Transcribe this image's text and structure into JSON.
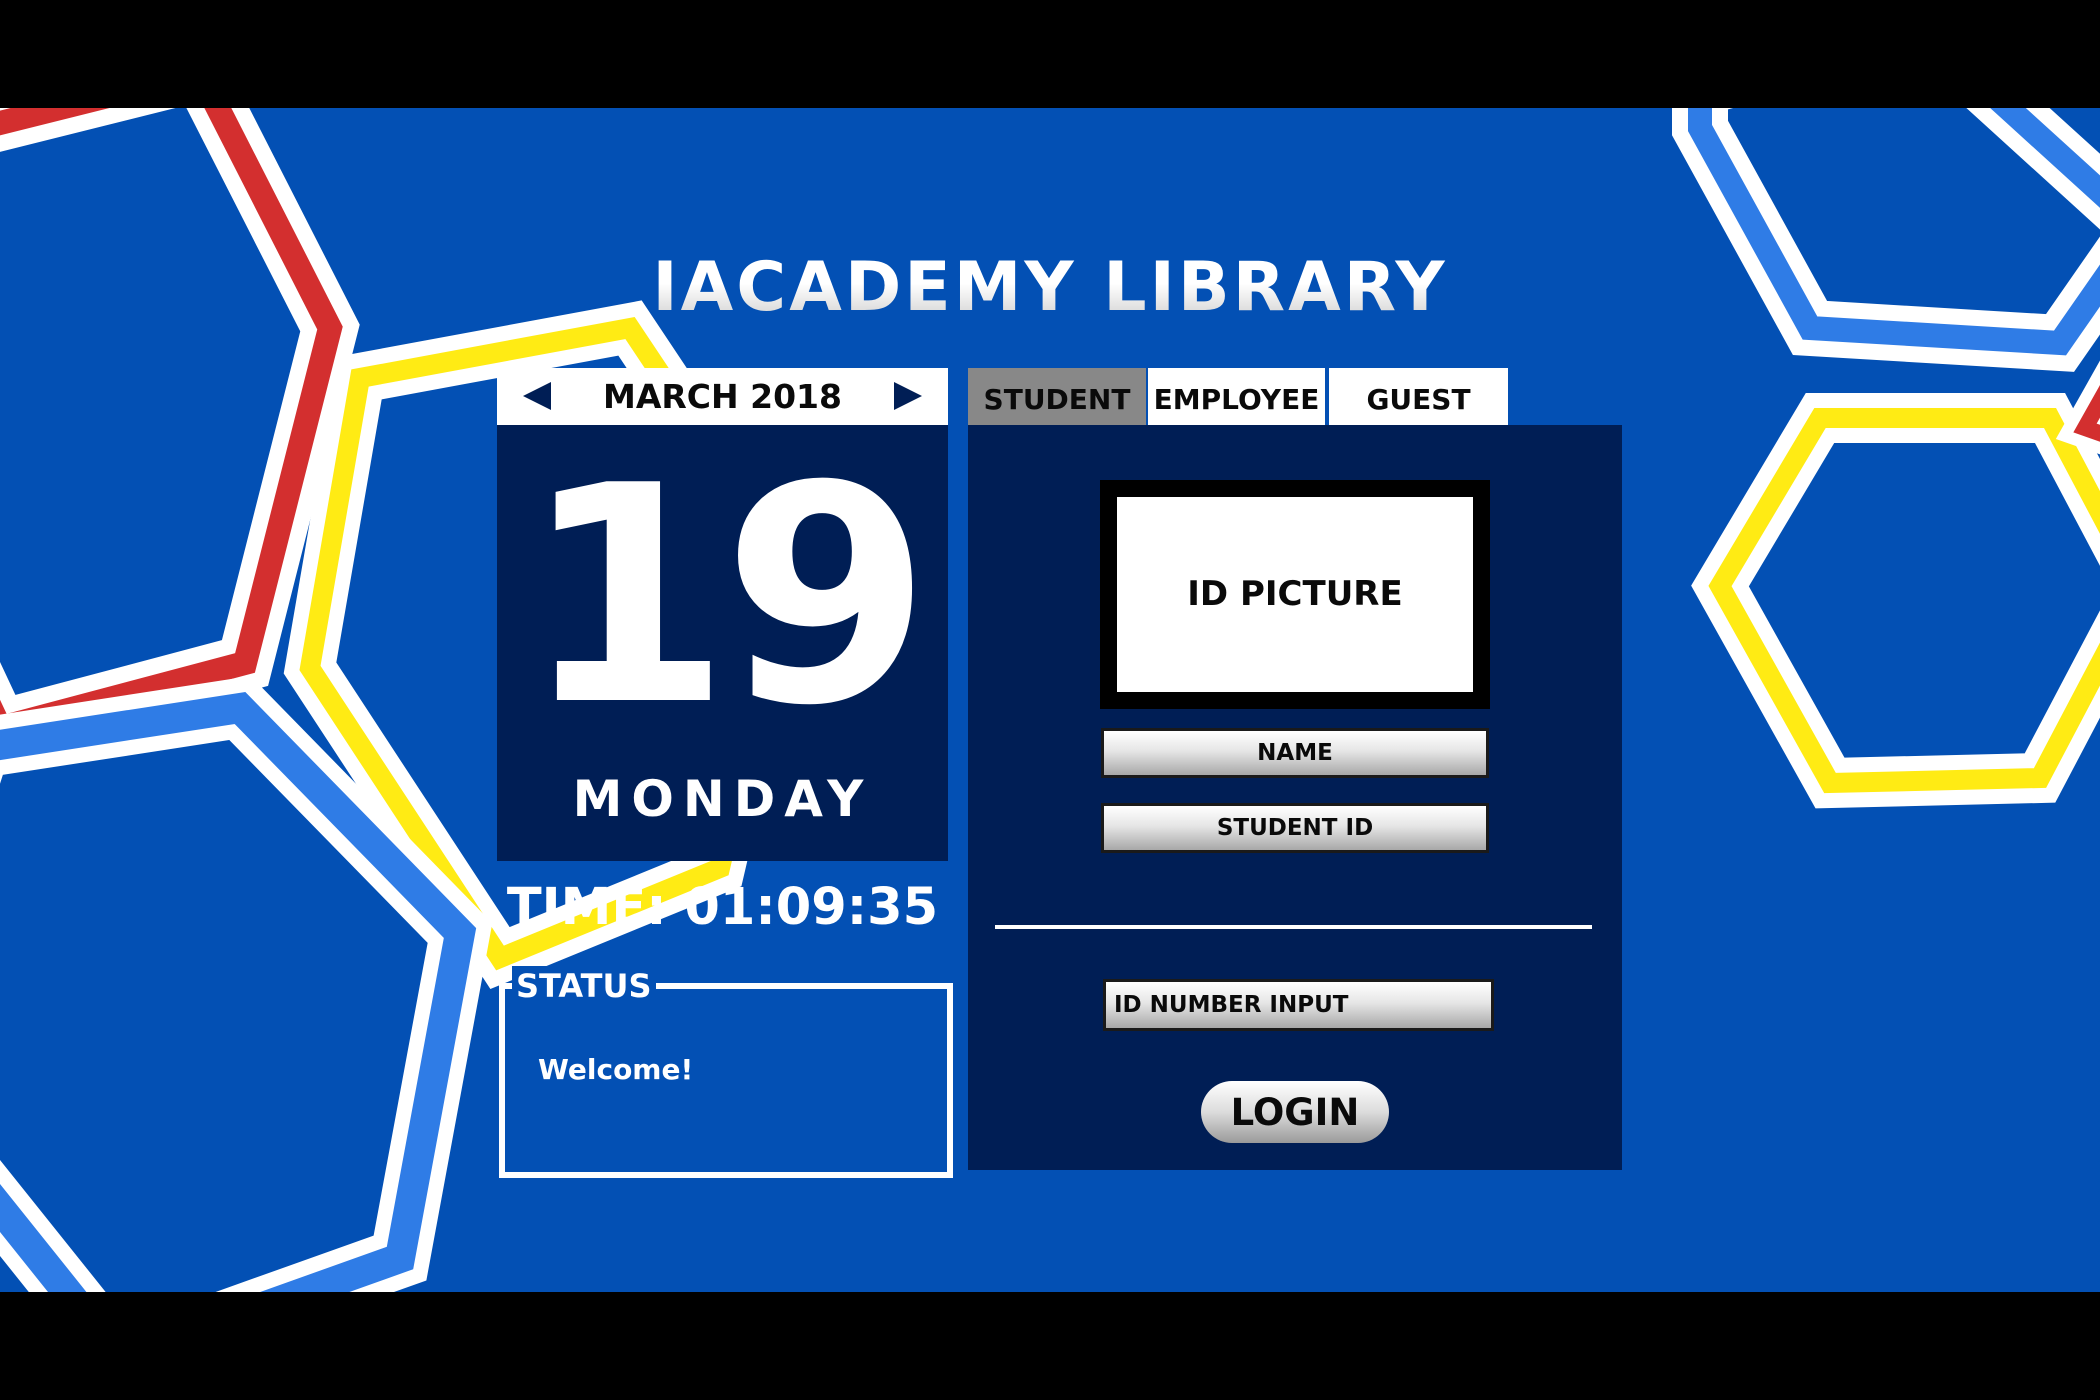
{
  "app": {
    "title": "IACADEMY LIBRARY"
  },
  "calendar": {
    "prev_icon": "triangle-left",
    "next_icon": "triangle-right",
    "month_year": "MARCH 2018",
    "day_number": "19",
    "weekday": "MONDAY"
  },
  "clock": {
    "time_text": "TIME: 01:09:35"
  },
  "status": {
    "label": "STATUS",
    "message": "Welcome!"
  },
  "tabs": [
    {
      "label": "STUDENT",
      "active": true
    },
    {
      "label": "EMPLOYEE",
      "active": false
    },
    {
      "label": "GUEST",
      "active": false
    }
  ],
  "login_form": {
    "id_picture_label": "ID PICTURE",
    "name_label": "NAME",
    "student_id_label": "STUDENT ID",
    "id_input_placeholder": "ID NUMBER INPUT",
    "id_input_value": "",
    "login_label": "LOGIN"
  },
  "colors": {
    "background": "#0350B4",
    "panel": "#001E55",
    "hex_red": "#D32F2F",
    "hex_yellow": "#FFEB14",
    "hex_lightblue": "#2F7CE6",
    "hex_outline": "#FFFFFF",
    "active_tab": "#888888"
  }
}
